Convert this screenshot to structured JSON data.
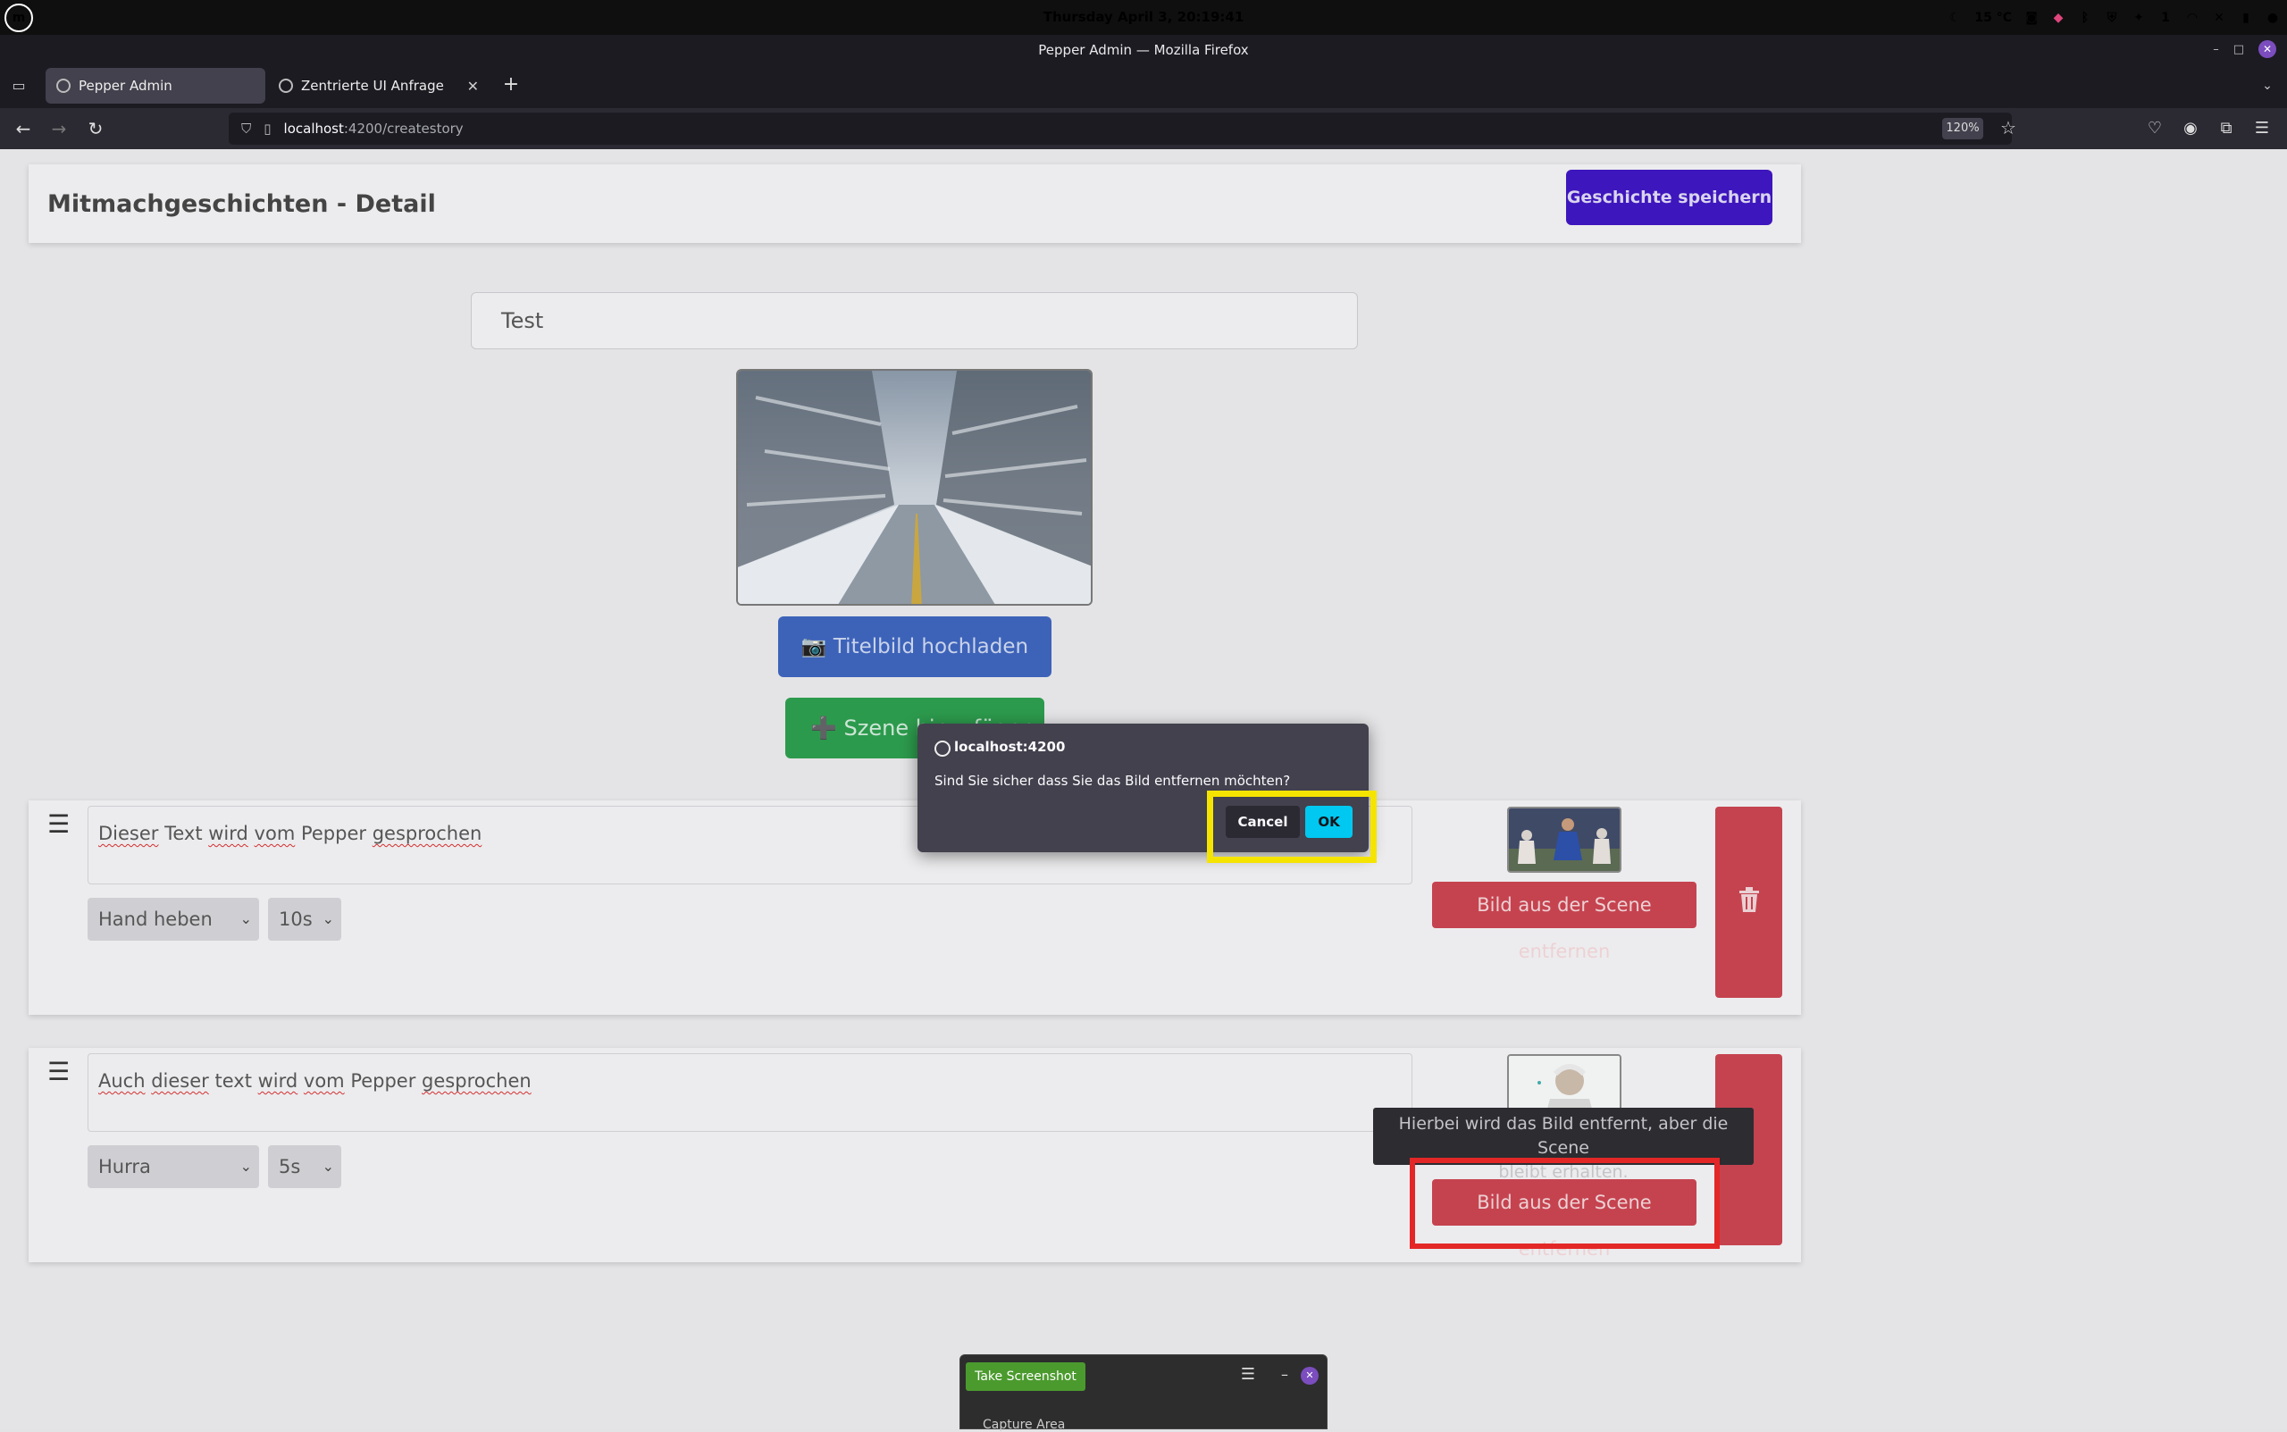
{
  "system": {
    "logo_text": "m",
    "clock": "Thursday April 3, 20:19:41",
    "weather": "15 °C",
    "notifications_count": "1"
  },
  "window": {
    "title": "Pepper Admin — Mozilla Firefox"
  },
  "tabs": [
    {
      "label": "Pepper Admin",
      "active": true
    },
    {
      "label": "Zentrierte UI Anfrage",
      "active": false
    }
  ],
  "urlbar": {
    "host": "localhost",
    "path": ":4200/createstory",
    "zoom": "120%"
  },
  "page": {
    "title": "Mitmachgeschichten - Detail",
    "save_label": "Geschichte speichern",
    "story_title_value": "Test",
    "upload_label": "📷 Titelbild hochladen",
    "add_scene_label": "➕ Szene hinzufügen"
  },
  "scenes": [
    {
      "text_words": [
        "Dieser",
        " Text ",
        "wird",
        " ",
        "vom",
        " Pepper ",
        "gesprochen"
      ],
      "gesture": "Hand heben",
      "duration": "10s",
      "remove_image_label": "Bild aus der Scene entfernen"
    },
    {
      "text_words": [
        "Auch",
        " ",
        "dieser",
        " text ",
        "wird",
        " ",
        "vom",
        " Pepper ",
        "gesprochen"
      ],
      "gesture": "Hurra",
      "duration": "5s",
      "remove_image_label": "Bild aus der Scene entfernen"
    }
  ],
  "tooltip": {
    "line1": "Hierbei wird das Bild entfernt, aber die Scene",
    "line2": "bleibt erhalten."
  },
  "dialog": {
    "origin": "localhost:4200",
    "message": "Sind Sie sicher dass Sie das Bild entfernen möchten?",
    "cancel_label": "Cancel",
    "ok_label": "OK"
  },
  "screenshot_tool": {
    "take_label": "Take Screenshot",
    "capture_label": "Capture Area"
  },
  "colors": {
    "primary": "#3e16bd",
    "danger": "#c5434f",
    "success": "#2c9a4c",
    "info": "#3d63b9",
    "highlight_red": "#e32727",
    "highlight_yellow": "#f5e400"
  }
}
